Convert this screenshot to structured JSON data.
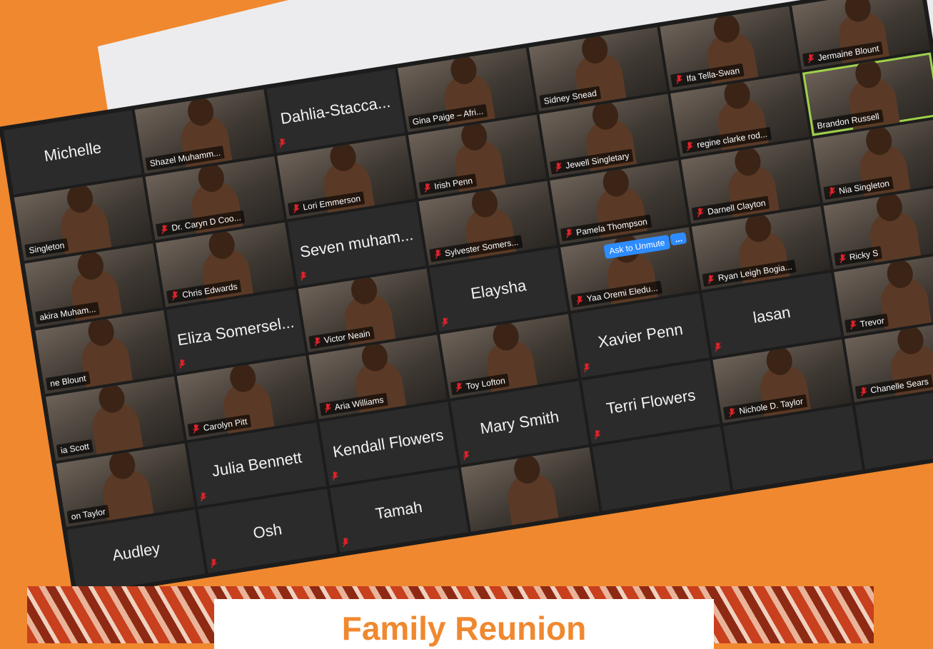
{
  "colors": {
    "background": "#f0882f",
    "paper": "#ececee",
    "screen": "#1c1c1c",
    "tile": "#2b2b2b",
    "active_speaker": "#9fd14a",
    "accent_button": "#2d8cff",
    "muted_mic": "#e0222a",
    "banner_text": "#f0882f"
  },
  "gallery": {
    "tiles": [
      {
        "name": "Michelle",
        "video": false,
        "muted": false
      },
      {
        "name": "Shazel Muhamm...",
        "video": true,
        "muted": false
      },
      {
        "name": "Dahlia-Stacca...",
        "video": false,
        "muted": true
      },
      {
        "name": "Gina Paige – Afri...",
        "video": true,
        "muted": false
      },
      {
        "name": "Sidney Snead",
        "video": true,
        "muted": false
      },
      {
        "name": "Ifa Tella-Swan",
        "video": true,
        "muted": true
      },
      {
        "name": "Jermaine Blount",
        "video": true,
        "muted": true
      },
      {
        "name": "Singleton",
        "video": true,
        "muted": false
      },
      {
        "name": "Dr. Caryn D Coo...",
        "video": true,
        "muted": true
      },
      {
        "name": "Lori Emmerson",
        "video": true,
        "muted": true
      },
      {
        "name": "Irish Penn",
        "video": true,
        "muted": true
      },
      {
        "name": "Jewell Singletary",
        "video": true,
        "muted": true
      },
      {
        "name": "regine clarke rod...",
        "video": true,
        "muted": true
      },
      {
        "name": "Brandon Russell",
        "video": true,
        "muted": false,
        "active": true
      },
      {
        "name": "akira Muham...",
        "video": true,
        "muted": false
      },
      {
        "name": "Chris Edwards",
        "video": true,
        "muted": true
      },
      {
        "name": "Seven muham...",
        "video": false,
        "muted": true
      },
      {
        "name": "Sylvester Somers...",
        "video": true,
        "muted": true
      },
      {
        "name": "Pamela Thompson",
        "video": true,
        "muted": true
      },
      {
        "name": "Darnell Clayton",
        "video": true,
        "muted": true
      },
      {
        "name": "Nia Singleton",
        "video": true,
        "muted": true
      },
      {
        "name": "ne Blount",
        "video": true,
        "muted": false
      },
      {
        "name": "Eliza Somersel...",
        "video": false,
        "muted": true
      },
      {
        "name": "Victor Neain",
        "video": true,
        "muted": true
      },
      {
        "name": "Elaysha",
        "video": false,
        "muted": true
      },
      {
        "name": "Yaa Oremi Eledu...",
        "video": true,
        "muted": true,
        "ask_unmute": true
      },
      {
        "name": "Ryan Leigh Bogia...",
        "video": true,
        "muted": true
      },
      {
        "name": "Ricky S",
        "video": true,
        "muted": true
      },
      {
        "name": "ia Scott",
        "video": true,
        "muted": false
      },
      {
        "name": "Carolyn Pitt",
        "video": true,
        "muted": true
      },
      {
        "name": "Aria Williams",
        "video": true,
        "muted": true
      },
      {
        "name": "Toy Lofton",
        "video": true,
        "muted": true
      },
      {
        "name": "Xavier Penn",
        "video": false,
        "muted": true
      },
      {
        "name": "lasan",
        "video": false,
        "muted": true
      },
      {
        "name": "Trevor",
        "video": true,
        "muted": true
      },
      {
        "name": "on Taylor",
        "video": true,
        "muted": false
      },
      {
        "name": "Julia Bennett",
        "video": false,
        "muted": true
      },
      {
        "name": "Kendall Flowers",
        "video": false,
        "muted": true
      },
      {
        "name": "Mary Smith",
        "video": false,
        "muted": true
      },
      {
        "name": "Terri Flowers",
        "video": false,
        "muted": true
      },
      {
        "name": "Nichole D. Taylor",
        "video": true,
        "muted": true
      },
      {
        "name": "Chanelle Sears",
        "video": true,
        "muted": true
      },
      {
        "name": "Audley",
        "video": false,
        "muted": false
      },
      {
        "name": "Osh",
        "video": false,
        "muted": true
      },
      {
        "name": "Tamah",
        "video": false,
        "muted": true
      },
      {
        "name": "",
        "video": true,
        "muted": false
      },
      {
        "name": "",
        "video": false,
        "muted": false
      },
      {
        "name": "",
        "video": false,
        "muted": false
      },
      {
        "name": "",
        "video": false,
        "muted": false
      }
    ],
    "ask_to_unmute_label": "Ask to Unmute",
    "more_label": "..."
  },
  "banner": {
    "title_partial": "Family Reunion"
  }
}
